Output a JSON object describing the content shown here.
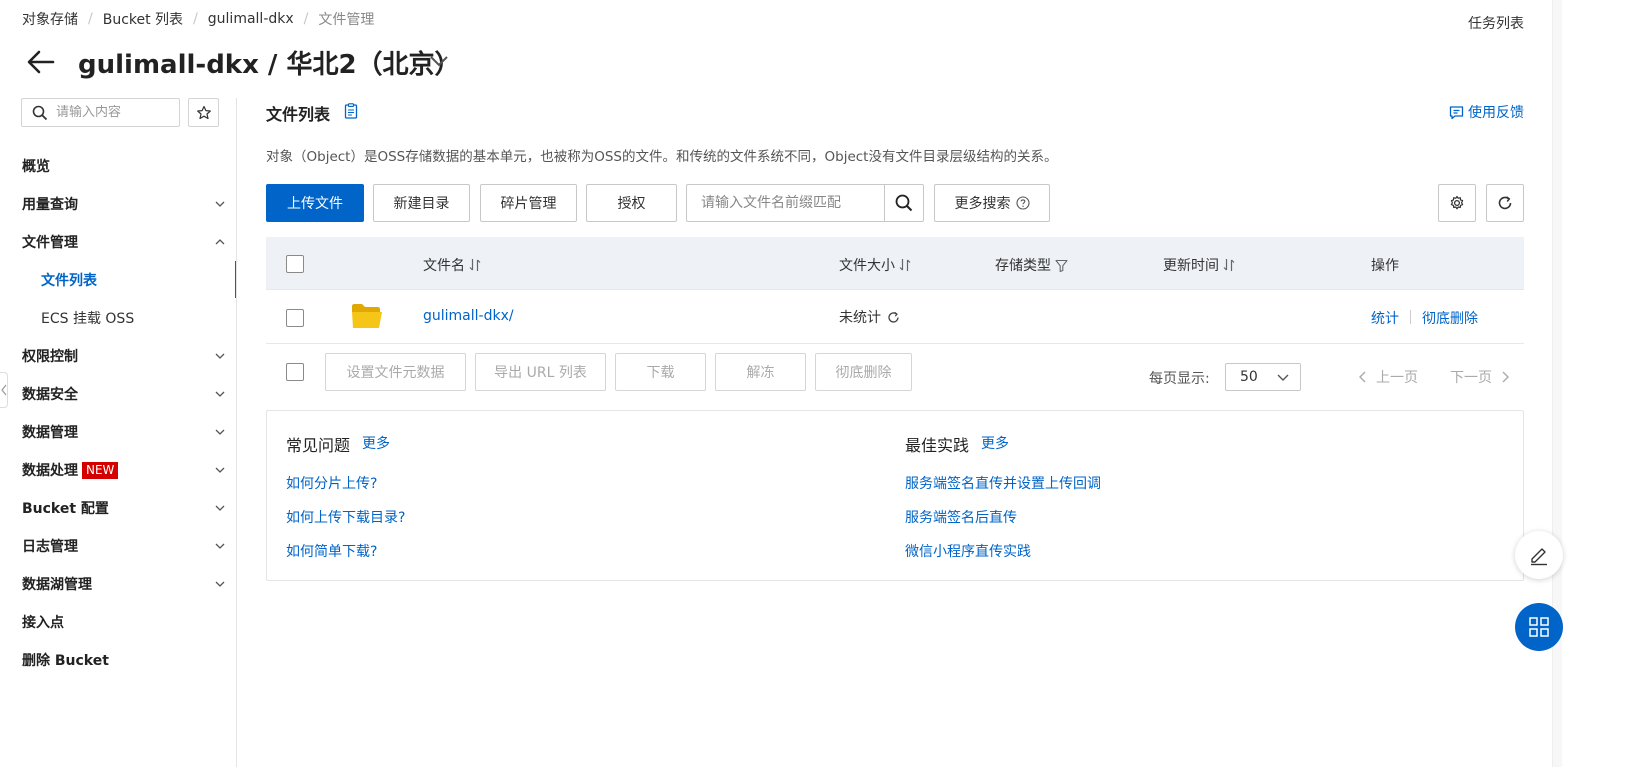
{
  "breadcrumb": {
    "items": [
      "对象存储",
      "Bucket 列表",
      "gulimall-dkx",
      "文件管理"
    ],
    "separator": "/"
  },
  "header": {
    "task_list": "任务列表",
    "title": "gulimall-dkx / 华北2（北京）"
  },
  "sidebar": {
    "search_placeholder": "请输入内容",
    "items": [
      {
        "label": "概览"
      },
      {
        "label": "用量查询"
      },
      {
        "label": "文件管理"
      },
      {
        "label": "文件列表"
      },
      {
        "label": "ECS 挂载 OSS"
      },
      {
        "label": "权限控制"
      },
      {
        "label": "数据安全"
      },
      {
        "label": "数据管理"
      },
      {
        "label": "数据处理",
        "badge": "NEW"
      },
      {
        "label": "Bucket 配置"
      },
      {
        "label": "日志管理"
      },
      {
        "label": "数据湖管理"
      },
      {
        "label": "接入点"
      },
      {
        "label": "删除 Bucket"
      }
    ]
  },
  "main": {
    "section_title": "文件列表",
    "feedback": "使用反馈",
    "description": "对象（Object）是OSS存储数据的基本单元，也被称为OSS的文件。和传统的文件系统不同，Object没有文件目录层级结构的关系。",
    "toolbar": {
      "upload": "上传文件",
      "new_dir": "新建目录",
      "fragments": "碎片管理",
      "authorize": "授权",
      "search_placeholder": "请输入文件名前缀匹配",
      "more_search": "更多搜索"
    },
    "table": {
      "columns": [
        "文件名",
        "文件大小",
        "存储类型",
        "更新时间",
        "操作"
      ],
      "rows": [
        {
          "name": "gulimall-dkx/",
          "size": "未统计",
          "storage_type": "",
          "updated": "",
          "actions": [
            "统计",
            "彻底删除"
          ]
        }
      ]
    },
    "batch_actions": [
      "设置文件元数据",
      "导出 URL 列表",
      "下载",
      "解冻",
      "彻底删除"
    ],
    "pagination": {
      "per_page_label": "每页显示:",
      "per_page_value": "50",
      "prev": "上一页",
      "next": "下一页"
    },
    "help": {
      "faq_title": "常见问题",
      "faq_more": "更多",
      "faq_links": [
        "如何分片上传?",
        "如何上传下载目录?",
        "如何简单下载?"
      ],
      "best_title": "最佳实践",
      "best_more": "更多",
      "best_links": [
        "服务端签名直传并设置上传回调",
        "服务端签名后直传",
        "微信小程序直传实践"
      ]
    }
  },
  "colors": {
    "accent": "#0064c8",
    "badge": "#d40000",
    "table_header_bg": "#eef1f6",
    "folder": "#f5c518"
  },
  "icons": [
    "back-arrow-icon",
    "chevron-down-icon",
    "search-icon",
    "star-icon",
    "doc-icon",
    "feedback-icon",
    "gear-icon",
    "refresh-icon",
    "sort-icon",
    "filter-icon",
    "folder-icon",
    "chevron-left-icon",
    "chevron-right-icon",
    "edit-icon",
    "grid-icon"
  ]
}
